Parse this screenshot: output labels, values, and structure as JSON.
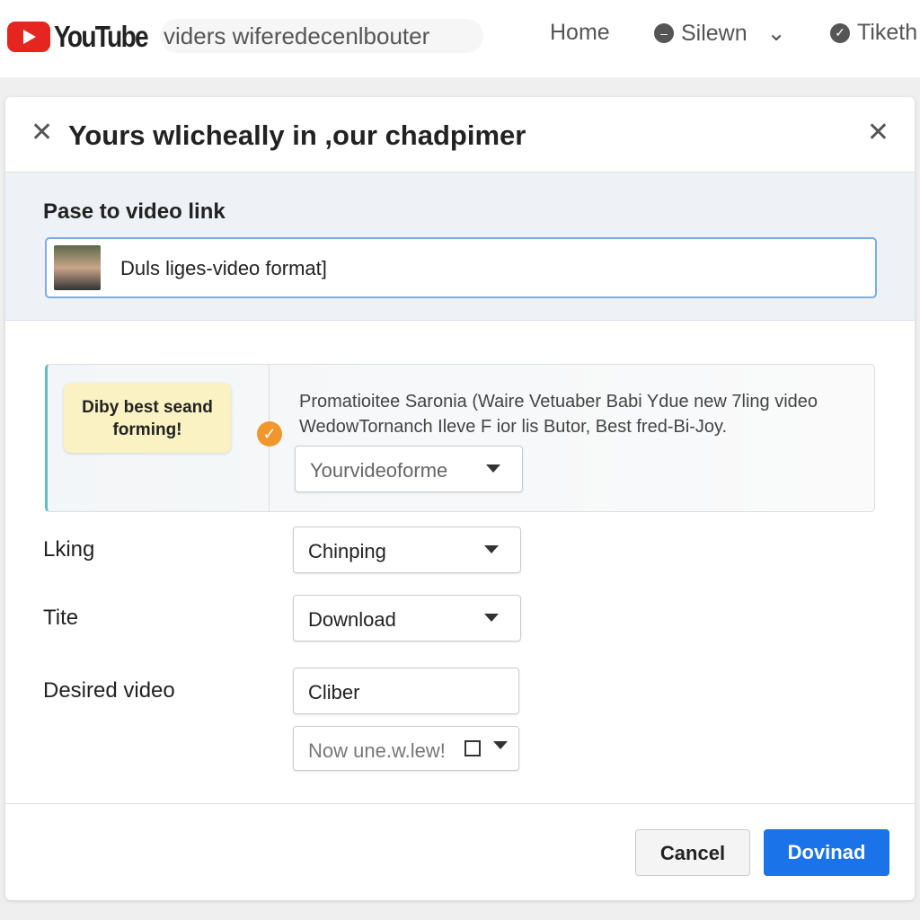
{
  "topbar": {
    "logo": "YouTube",
    "search": "viders wiferedecenlbouter",
    "nav": [
      "Home",
      "Silewn",
      "Tiketh"
    ]
  },
  "dialog": {
    "title": "Yours wlicheally in ,our chadpimer",
    "link_label": "Pase to video link",
    "link_value": "Duls liges-video format]",
    "promo": {
      "bubble": "Diby best seand forming!",
      "desc": "Promatioitee Saronia (Waire Vetuaber Babi Ydue new 7ling video WedowTornanch Ileve F ior lis Butor, Best fred-Bi-Joy.",
      "select": "Yourvideoforme"
    },
    "fields": [
      {
        "label": "Lking",
        "value": "Chinping"
      },
      {
        "label": "Tite",
        "value": "Download"
      },
      {
        "label": "Desired video",
        "value": "Cliber",
        "extra": "Now une.w.lew!"
      }
    ],
    "cancel": "Cancel",
    "download": "Dovinad"
  },
  "colors": {
    "accent": "#1a73e8",
    "brand": "#e5251f"
  }
}
